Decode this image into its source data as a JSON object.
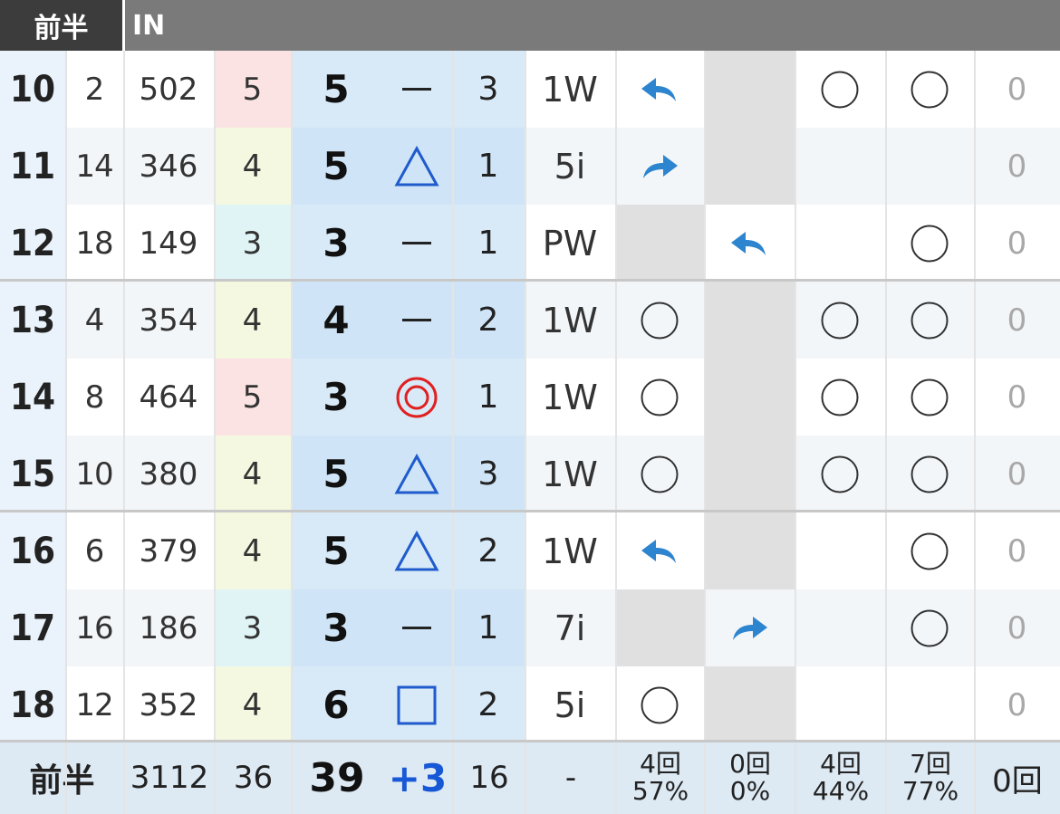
{
  "header": {
    "tab_label": "前半",
    "title": "IN"
  },
  "columns": [
    "hole",
    "hcp",
    "yard",
    "par",
    "score",
    "result",
    "putts",
    "club",
    "fairway",
    "fairway_stat",
    "par_on",
    "one_putt",
    "penalty"
  ],
  "colors": {
    "header_bg": "#7a7a7a",
    "tab_bg": "#3c3c3c",
    "score_blue": "#d8eaf8",
    "score_blue_alt": "#cfe5f7",
    "par5_bg": "#fbe3e3",
    "par4_bg": "#f4f8e0",
    "par3_bg": "#e0f4f6",
    "gray_block": "#e0e0e0",
    "arrow_blue": "#2d84cf",
    "triangle_blue": "#1f5bcc",
    "double_circle_red": "#e02020",
    "total_bg": "#dde9f3",
    "diff_blue": "#1758d6"
  },
  "holes": [
    {
      "hole": "10",
      "hcp": "2",
      "yard": "502",
      "par": "5",
      "score": "5",
      "result": "dash",
      "putts": "3",
      "club": "1W",
      "fairway": "arrow-left",
      "fairway_stat": "none",
      "par_on": "circle",
      "one_putt": "circle",
      "penalty": "0"
    },
    {
      "hole": "11",
      "hcp": "14",
      "yard": "346",
      "par": "4",
      "score": "5",
      "result": "triangle",
      "putts": "1",
      "club": "5i",
      "fairway": "arrow-right",
      "fairway_stat": "none",
      "par_on": "none",
      "one_putt": "none",
      "penalty": "0"
    },
    {
      "hole": "12",
      "hcp": "18",
      "yard": "149",
      "par": "3",
      "score": "3",
      "result": "dash",
      "putts": "1",
      "club": "PW",
      "fairway": "gray",
      "fairway_stat": "arrow-left",
      "par_on": "none",
      "one_putt": "circle",
      "penalty": "0"
    },
    {
      "hole": "13",
      "hcp": "4",
      "yard": "354",
      "par": "4",
      "score": "4",
      "result": "dash",
      "putts": "2",
      "club": "1W",
      "fairway": "circle",
      "fairway_stat": "none",
      "par_on": "circle",
      "one_putt": "circle",
      "penalty": "0"
    },
    {
      "hole": "14",
      "hcp": "8",
      "yard": "464",
      "par": "5",
      "score": "3",
      "result": "double-circle",
      "putts": "1",
      "club": "1W",
      "fairway": "circle",
      "fairway_stat": "none",
      "par_on": "circle",
      "one_putt": "circle",
      "penalty": "0"
    },
    {
      "hole": "15",
      "hcp": "10",
      "yard": "380",
      "par": "4",
      "score": "5",
      "result": "triangle",
      "putts": "3",
      "club": "1W",
      "fairway": "circle",
      "fairway_stat": "none",
      "par_on": "circle",
      "one_putt": "circle",
      "penalty": "0"
    },
    {
      "hole": "16",
      "hcp": "6",
      "yard": "379",
      "par": "4",
      "score": "5",
      "result": "triangle",
      "putts": "2",
      "club": "1W",
      "fairway": "arrow-left",
      "fairway_stat": "none",
      "par_on": "none",
      "one_putt": "circle",
      "penalty": "0"
    },
    {
      "hole": "17",
      "hcp": "16",
      "yard": "186",
      "par": "3",
      "score": "3",
      "result": "dash",
      "putts": "1",
      "club": "7i",
      "fairway": "gray",
      "fairway_stat": "arrow-right",
      "par_on": "none",
      "one_putt": "circle",
      "penalty": "0"
    },
    {
      "hole": "18",
      "hcp": "12",
      "yard": "352",
      "par": "4",
      "score": "6",
      "result": "square",
      "putts": "2",
      "club": "5i",
      "fairway": "circle",
      "fairway_stat": "none",
      "par_on": "none",
      "one_putt": "none",
      "penalty": "0"
    }
  ],
  "total": {
    "label": "前半",
    "yard": "3112",
    "par": "36",
    "score": "39",
    "diff": "+3",
    "putts": "16",
    "club": "-",
    "fairway_count": "4回",
    "fairway_pct": "57%",
    "fairway_stat_count": "0回",
    "fairway_stat_pct": "0%",
    "par_on_count": "4回",
    "par_on_pct": "44%",
    "one_putt_count": "7回",
    "one_putt_pct": "77%",
    "penalty": "0回"
  }
}
